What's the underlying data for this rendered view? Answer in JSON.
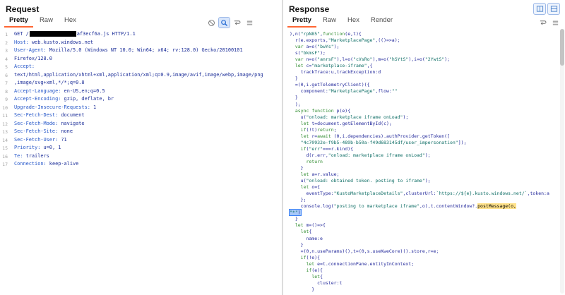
{
  "accent": {
    "tab_underline": "#ff6633",
    "selection": "#a8c8f8",
    "search_highlight": "#ffe28a"
  },
  "request": {
    "title": "Request",
    "tabs": [
      {
        "label": "Pretty",
        "active": true
      },
      {
        "label": "Raw",
        "active": false
      },
      {
        "label": "Hex",
        "active": false
      }
    ],
    "toolbar": [
      {
        "icon": "ban-icon",
        "active": false
      },
      {
        "icon": "search-icon",
        "active": true
      },
      {
        "icon": "wrap-icon",
        "active": false
      },
      {
        "icon": "menu-icon",
        "active": false
      }
    ],
    "lines": [
      {
        "n": "1",
        "parts": [
          {
            "t": "GET /",
            "c": "hv"
          },
          {
            "redact": 66
          },
          {
            "t": "af3ecf6a.js HTTP/1.1",
            "c": "hv"
          }
        ]
      },
      {
        "n": "2",
        "parts": [
          {
            "t": "Host:",
            "c": "hn"
          },
          {
            "t": " web.kusto.windows.net",
            "c": "hv"
          }
        ]
      },
      {
        "n": "3",
        "parts": [
          {
            "t": "User-Agent:",
            "c": "hn"
          },
          {
            "t": " Mozilla/5.0 (Windows NT 10.0; Win64; x64; rv:128.0) Gecko/20100101",
            "c": "hv"
          }
        ]
      },
      {
        "n": "4",
        "parts": [
          {
            "t": "Firefox/128.0",
            "c": "hv"
          }
        ]
      },
      {
        "n": "5",
        "parts": [
          {
            "t": "Accept:",
            "c": "hn"
          }
        ]
      },
      {
        "n": "6",
        "parts": [
          {
            "t": "text/html,application/xhtml+xml,application/xml;q=0.9,image/avif,image/webp,image/png",
            "c": "hv"
          }
        ]
      },
      {
        "n": "7",
        "parts": [
          {
            "t": ",image/svg+xml,*/*;q=0.8",
            "c": "hv"
          }
        ]
      },
      {
        "n": "8",
        "parts": [
          {
            "t": "Accept-Language:",
            "c": "hn"
          },
          {
            "t": " en-US,en;q=0.5",
            "c": "hv"
          }
        ]
      },
      {
        "n": "9",
        "parts": [
          {
            "t": "Accept-Encoding:",
            "c": "hn"
          },
          {
            "t": " gzip, deflate, br",
            "c": "hv"
          }
        ]
      },
      {
        "n": "10",
        "parts": [
          {
            "t": "Upgrade-Insecure-Requests:",
            "c": "hn"
          },
          {
            "t": " 1",
            "c": "hv"
          }
        ]
      },
      {
        "n": "11",
        "parts": [
          {
            "t": "Sec-Fetch-Dest:",
            "c": "hn"
          },
          {
            "t": " document",
            "c": "hv"
          }
        ]
      },
      {
        "n": "12",
        "parts": [
          {
            "t": "Sec-Fetch-Mode:",
            "c": "hn"
          },
          {
            "t": " navigate",
            "c": "hv"
          }
        ]
      },
      {
        "n": "13",
        "parts": [
          {
            "t": "Sec-Fetch-Site:",
            "c": "hn"
          },
          {
            "t": " none",
            "c": "hv"
          }
        ]
      },
      {
        "n": "14",
        "parts": [
          {
            "t": "Sec-Fetch-User:",
            "c": "hn"
          },
          {
            "t": " ?1",
            "c": "hv"
          }
        ]
      },
      {
        "n": "15",
        "parts": [
          {
            "t": "Priority:",
            "c": "hn"
          },
          {
            "t": " u=0, 1",
            "c": "hv"
          }
        ]
      },
      {
        "n": "16",
        "parts": [
          {
            "t": "Te:",
            "c": "hn"
          },
          {
            "t": " trailers",
            "c": "hv"
          }
        ]
      },
      {
        "n": "17",
        "parts": [
          {
            "t": "Connection:",
            "c": "hn"
          },
          {
            "t": " keep-alive",
            "c": "hv"
          }
        ]
      }
    ]
  },
  "response": {
    "title": "Response",
    "tabs": [
      {
        "label": "Pretty",
        "active": true
      },
      {
        "label": "Raw",
        "active": false
      },
      {
        "label": "Hex",
        "active": false
      },
      {
        "label": "Render",
        "active": false
      }
    ],
    "toolbar": [
      {
        "icon": "wrap-icon",
        "active": false
      },
      {
        "icon": "menu-icon",
        "active": false
      }
    ],
    "window_icons": [
      {
        "icon": "layout-columns-icon",
        "active": false
      },
      {
        "icon": "layout-rows-icon",
        "active": false
      }
    ],
    "code_lines": [
      {
        "t": "),n(\"rpN85\",function(e,t){"
      },
      {
        "t": "  r(e.exports,\"MarketplacePage\",(()=>a);"
      },
      {
        "t": "  var a=o(\"bwYs\");"
      },
      {
        "t": "  s(\"bkmsF\");"
      },
      {
        "t": "  var n=o(\"anrsF\"),l=o(\"cVsRo\"),m=o(\"hSYtS\"),i=o(\"2YwtS\");"
      },
      {
        "t": "  let c=\"marketplace-iframe\",{"
      },
      {
        "t": "    trackTrace:u,trackException:d"
      },
      {
        "t": "  }"
      },
      {
        "t": "  =(0,i.getTelemetryClient)({"
      },
      {
        "t": "    component:\"MarketplacePage\",flow:\"\""
      },
      {
        "t": "  }"
      },
      {
        "t": "  );"
      },
      {
        "t": "  async function p(e){"
      },
      {
        "t": "    u(\"onload: marketplace iframe onLoad\");"
      },
      {
        "t": "    let t=document.getElementById(c);"
      },
      {
        "t": "    if(!t)return;"
      },
      {
        "t": "    let r=await (0,i.dependencies).authProvider.getToken(["
      },
      {
        "t": "    \"4c70932e-f9b5-489b-b50a-f49d683145df/user_impersonation\"]);"
      },
      {
        "t": "    if(\"err\"===r.kind){"
      },
      {
        "t": "      d(r.err,\"onload: marketplace iframe onLoad\");"
      },
      {
        "t": "      return"
      },
      {
        "t": "    }"
      },
      {
        "t": "    let a=r.value;"
      },
      {
        "t": "    u(\"onload: obtained token. posting to iframe\");"
      },
      {
        "t": "    let o={"
      },
      {
        "t": "      eventType:\"KustoMarketplaceDetails\",clusterUrl:`https://${e}.kusto.windows.net/`,token:a"
      },
      {
        "t": "    };"
      },
      {
        "t": "    console.log(\"posting to marketplace iframe\",o),t.contentWindow?.postMessage(o,",
        "mark": "postMessage(o,"
      },
      {
        "t": "\"*\")",
        "sel": true
      },
      {
        "t": "  }"
      },
      {
        "t": "  let m=()=>{"
      },
      {
        "t": "    let{"
      },
      {
        "t": "      name:e"
      },
      {
        "t": "    }"
      },
      {
        "t": "    =(0,n.useParams)(),t=(0,s.useKweCore)().store,r=e;"
      },
      {
        "t": "    if(!e){"
      },
      {
        "t": "      let e=t.connectionPane.entityInContext;"
      },
      {
        "t": "      if(e){"
      },
      {
        "t": "        let{"
      },
      {
        "t": "          cluster:t"
      },
      {
        "t": "        }"
      }
    ]
  }
}
